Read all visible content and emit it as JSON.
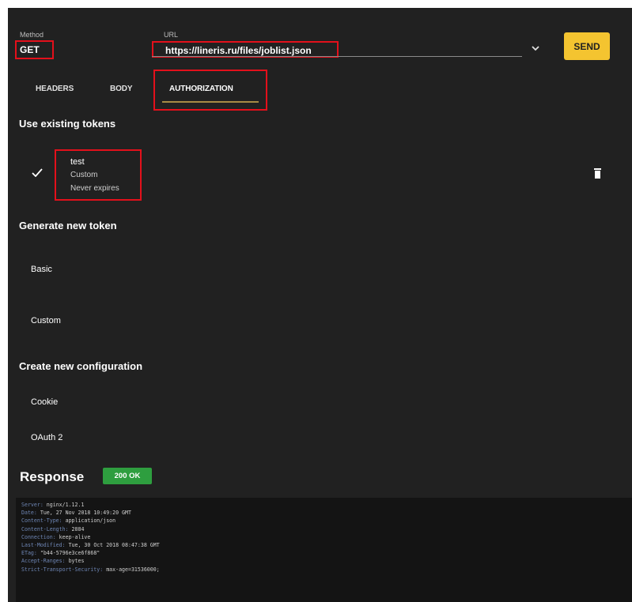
{
  "request": {
    "method_label": "Method",
    "method_value": "GET",
    "url_label": "URL",
    "url_value": "https://lineris.ru/files/joblist.json",
    "send_label": "SEND"
  },
  "tabs": [
    {
      "label": "HEADERS"
    },
    {
      "label": "BODY"
    },
    {
      "label": "AUTHORIZATION",
      "active": true
    }
  ],
  "existing_tokens": {
    "title": "Use existing tokens",
    "items": [
      {
        "name": "test",
        "type": "Custom",
        "expiry": "Never expires",
        "selected": true
      }
    ]
  },
  "generate_token": {
    "title": "Generate new token",
    "items": [
      {
        "label": "Basic"
      },
      {
        "label": "Custom"
      }
    ]
  },
  "new_configuration": {
    "title": "Create new configuration",
    "items": [
      {
        "label": "Cookie"
      },
      {
        "label": "OAuth 2"
      }
    ]
  },
  "response": {
    "title": "Response",
    "status": "200 OK",
    "headers": [
      {
        "key": "Server:",
        "value": "nginx/1.12.1"
      },
      {
        "key": "Date:",
        "value": "Tue, 27 Nov 2018 10:49:20 GMT"
      },
      {
        "key": "Content-Type:",
        "value": "application/json"
      },
      {
        "key": "Content-Length:",
        "value": "2884"
      },
      {
        "key": "Connection:",
        "value": "keep-alive"
      },
      {
        "key": "Last-Modified:",
        "value": "Tue, 30 Oct 2018 08:47:38 GMT"
      },
      {
        "key": "ETag:",
        "value": "\"b44-5796e3ce6f868\""
      },
      {
        "key": "Accept-Ranges:",
        "value": "bytes"
      },
      {
        "key": "Strict-Transport-Security:",
        "value": "max-age=31536000;"
      }
    ]
  },
  "colors": {
    "background": "#212121",
    "send_button": "#f4c430",
    "status_ok": "#2e9e3f",
    "highlight": "#e3101b",
    "tab_indicator": "#a68b45"
  },
  "icons": {
    "selected": "check-icon",
    "delete": "trash-icon",
    "dropdown": "chevron-down-icon"
  }
}
